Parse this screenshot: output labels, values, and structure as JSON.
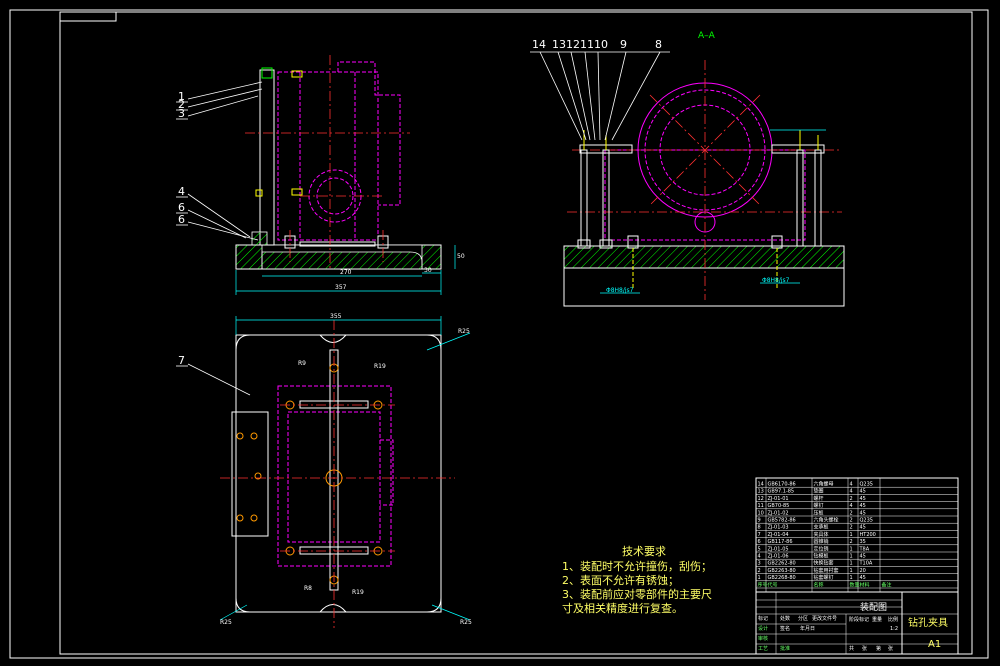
{
  "drawing": {
    "section_title": "A–A",
    "balloons_front": [
      "1",
      "2",
      "3",
      "4",
      "6",
      "6"
    ],
    "balloons_top": [
      "7"
    ],
    "balloons_section": [
      "14",
      "13",
      "12",
      "11",
      "10",
      "9",
      "8"
    ],
    "dims": {
      "d270": "270",
      "d357": "357",
      "d30": "30",
      "d50": "50",
      "d355": "355",
      "r25_tr": "R25",
      "r25_bl": "R25",
      "r25_br": "R25",
      "r9": "R9",
      "r19_top": "R19",
      "r8": "R8",
      "r19_bot": "R19",
      "fit_left": "Φ8H8/js7",
      "fit_right": "Φ8H8/js7"
    },
    "tech_requirements": {
      "title": "技术要求",
      "items": [
        "1、装配时不允许撞伤，刮伤；",
        "2、表面不允许有锈蚀；",
        "3、装配前应对零部件的主要尺",
        "寸及相关精度进行复查。"
      ]
    },
    "title_block": {
      "drawing_name": "装配图",
      "part_name": "钻孔夹具",
      "sheet_size": "A1",
      "bom_rows": [
        {
          "no": "14",
          "code": "GB6170-86",
          "name": "六角螺母",
          "qty": "4",
          "mat": "Q235"
        },
        {
          "no": "13",
          "code": "GB97.1-85",
          "name": "垫圈",
          "qty": "4",
          "mat": "45"
        },
        {
          "no": "12",
          "code": "ZJ-01-01",
          "name": "螺杆",
          "qty": "2",
          "mat": "45"
        },
        {
          "no": "11",
          "code": "GB70-85",
          "name": "螺钉",
          "qty": "4",
          "mat": "45"
        },
        {
          "no": "10",
          "code": "ZJ-01-02",
          "name": "压板",
          "qty": "2",
          "mat": "45"
        },
        {
          "no": "9",
          "code": "GB5782-86",
          "name": "六角头螺栓",
          "qty": "2",
          "mat": "Q235"
        },
        {
          "no": "8",
          "code": "ZJ-01-03",
          "name": "支承板",
          "qty": "2",
          "mat": "45"
        },
        {
          "no": "7",
          "code": "ZJ-01-04",
          "name": "夹具体",
          "qty": "1",
          "mat": "HT200"
        },
        {
          "no": "6",
          "code": "GB117-86",
          "name": "圆锥销",
          "qty": "2",
          "mat": "35"
        },
        {
          "no": "5",
          "code": "ZJ-01-05",
          "name": "定位销",
          "qty": "1",
          "mat": "T8A"
        },
        {
          "no": "4",
          "code": "ZJ-01-06",
          "name": "钻模板",
          "qty": "1",
          "mat": "45"
        },
        {
          "no": "3",
          "code": "GB2262-80",
          "name": "快换钻套",
          "qty": "1",
          "mat": "T10A"
        },
        {
          "no": "2",
          "code": "GB2263-80",
          "name": "钻套用衬套",
          "qty": "1",
          "mat": "20"
        },
        {
          "no": "1",
          "code": "GB2268-80",
          "name": "钻套螺钉",
          "qty": "1",
          "mat": "45"
        }
      ],
      "header": [
        "序号",
        "代号",
        "名称",
        "数量",
        "材料",
        "备注"
      ],
      "footer_labels": [
        "标记",
        "处数",
        "分区",
        "更改文件号",
        "签名",
        "年月日"
      ],
      "role_labels": [
        "设计",
        "审核",
        "工艺",
        "批准"
      ],
      "stage_labels": [
        "阶段标记",
        "重量",
        "比例"
      ],
      "ratio": "1:2",
      "sheet_labels": [
        "共",
        "张",
        "第",
        "张"
      ]
    }
  },
  "colors": {
    "background": "#000000",
    "outline": "#ffffff",
    "hidden": "#ff00ff",
    "center": "#ff3030",
    "hatch": "#00ff00",
    "dimension": "#00ffff",
    "note": "#ffff66"
  }
}
